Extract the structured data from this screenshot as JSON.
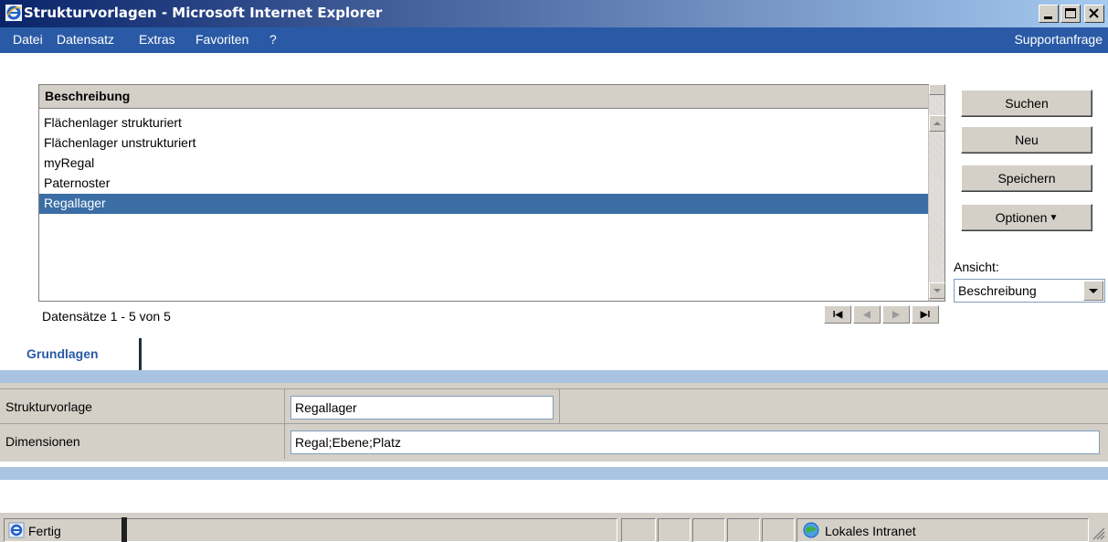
{
  "window": {
    "title": "Strukturvorlagen - Microsoft Internet Explorer",
    "icon": "ie-icon",
    "buttons": [
      "minimize",
      "maximize",
      "close"
    ]
  },
  "menu": {
    "items": [
      "Datei",
      "Datensatz",
      "Extras",
      "Favoriten",
      "?"
    ],
    "support": "Supportanfrage"
  },
  "grid": {
    "header": "Beschreibung",
    "rows": [
      "Flächenlager strukturiert",
      "Flächenlager unstrukturiert",
      "myRegal",
      "Paternoster",
      "Regallager"
    ],
    "selected_row": "Regallager",
    "record_info": "Datensätze 1 - 5 von 5"
  },
  "actions": {
    "search": "Suchen",
    "new": "Neu",
    "save": "Speichern",
    "options": "Optionen"
  },
  "view": {
    "label": "Ansicht:",
    "selected": "Beschreibung"
  },
  "tabs": [
    "Grundlagen"
  ],
  "form": {
    "template_label": "Strukturvorlage",
    "template_value": "Regallager",
    "dimensions_label": "Dimensionen",
    "dimensions_value": "Regal;Ebene;Platz"
  },
  "status": {
    "text": "Fertig",
    "zone": "Lokales Intranet"
  },
  "colors": {
    "menubar": "#2a5aa6",
    "selection": "#3a6ea5",
    "accent_bar": "#a8c4e0",
    "tab_text": "#2a5aa6"
  }
}
